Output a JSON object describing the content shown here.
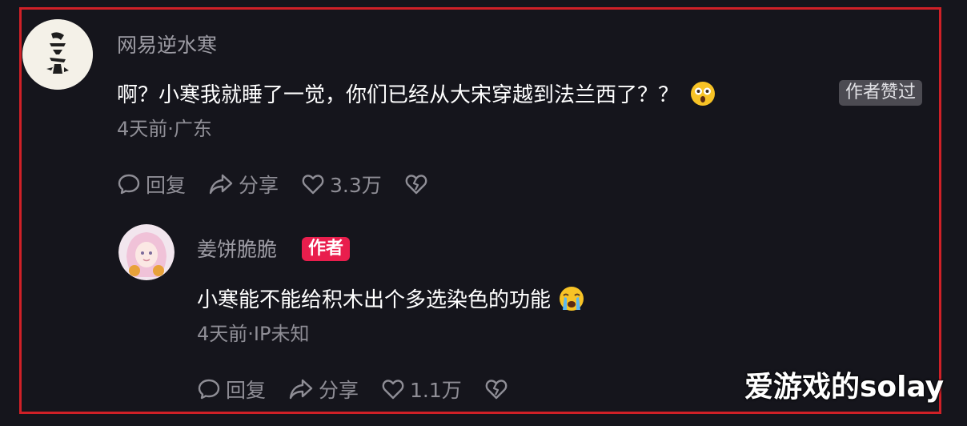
{
  "comments": [
    {
      "username": "网易逆水寒",
      "content": "啊？小寒我就睡了一觉，你们已经从大宋穿越到法兰西了？？",
      "emoji": "astonished-face-emoji",
      "author_liked_badge": "作者赞过",
      "meta": "4天前·广东",
      "actions": {
        "reply": "回复",
        "share": "分享",
        "likes": "3.3万"
      }
    },
    {
      "username": "姜饼脆脆",
      "author_tag": "作者",
      "content": "小寒能不能给积木出个多选染色的功能",
      "emoji": "loudly-crying-face-emoji",
      "meta": "4天前·IP未知",
      "actions": {
        "reply": "回复",
        "share": "分享",
        "likes": "1.1万"
      }
    }
  ],
  "watermark": "爱游戏的solay",
  "colors": {
    "background": "#15151c",
    "frame_border": "#cf2027",
    "author_tag": "#e91e4d",
    "text_muted": "#8f8e96"
  }
}
